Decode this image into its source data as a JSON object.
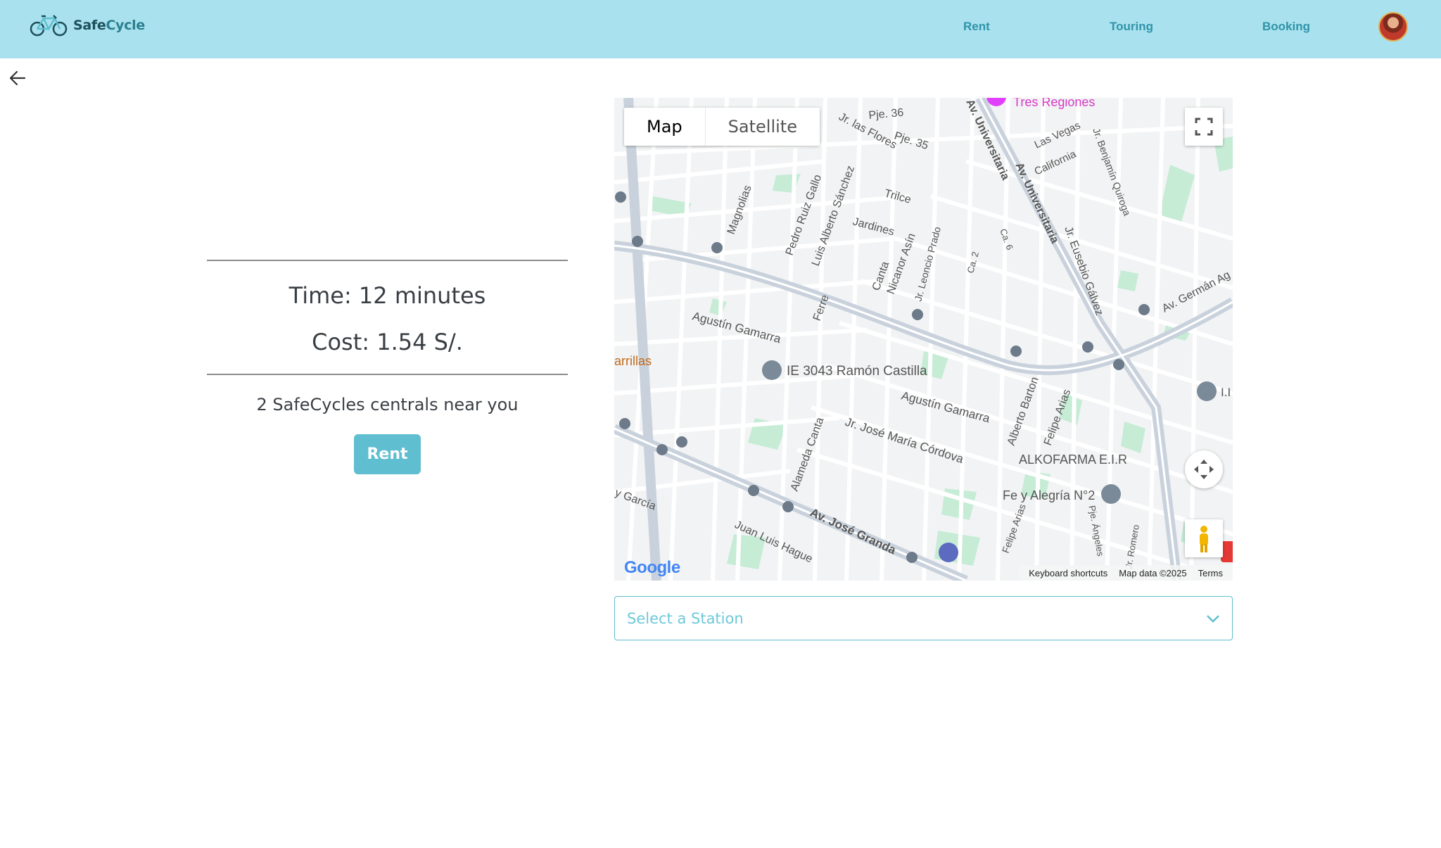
{
  "brand": {
    "name_part1": "Safe",
    "name_part2": "Cycle"
  },
  "nav": {
    "rent": "Rent",
    "touring": "Touring",
    "booking": "Booking"
  },
  "summary": {
    "time": "Time: 12 minutes",
    "cost": "Cost: 1.54 S/.",
    "centrals": "2 SafeCycles centrals near you",
    "rent_button": "Rent"
  },
  "map": {
    "type_map": "Map",
    "type_satellite": "Satellite",
    "google": "Google",
    "keyboard_shortcuts": "Keyboard shortcuts",
    "map_data": "Map data ©2025",
    "terms": "Terms",
    "labels": {
      "tres_regiones": "Tres Regiones",
      "pje36": "Pje. 36",
      "pje35": "Pje. 35",
      "las_flores": "Jr. las Flores",
      "las_vegas": "Las Vegas",
      "california": "California",
      "av_universitaria": "Av. Universitaria",
      "av_universitaria2": "Av. Universitaria",
      "benjamin": "Jr. Benjamín Quiroga",
      "magnolias": "Magnolias",
      "pedro": "Pedro Ruiz Gallo",
      "luis_alberto": "Luis Alberto Sánchez",
      "trilce": "Trilce",
      "jardines": "Jardines",
      "nicanor": "Nicanor Asín",
      "leoncio": "Jr. Leoncio Prado",
      "ca2": "Ca. 2",
      "ca6": "Ca. 6",
      "eusebio": "Jr. Eusebio Gálvez",
      "german": "Av. Germán Ag",
      "canta": "Canta",
      "ferre": "Ferre",
      "gamarra1": "Agustín Gamarra",
      "gamarra2": "Agustín Gamarra",
      "barrillas": "arrillas",
      "ie3043": "IE 3043 Ramón Castilla",
      "alberto_barton": "Alberto Barton",
      "felipe_arias": "Felipe Arias",
      "felipe_arias2": "Felipe Arias",
      "cordova": "Jr. José María Córdova",
      "alkofarma": "ALKOFARMA E.I.R",
      "fe_alegria": "Fe y Alegría N°2",
      "alameda": "Alameda Canta",
      "garcia": "y García",
      "av_jose_granda": "Av. José Granda",
      "juan_luis": "Juan Luis Hague",
      "romero": "Jr. Romero",
      "angeles": "Pje. Ángeles",
      "i_i": "I.I"
    }
  },
  "station_select": {
    "placeholder": "Select a Station"
  },
  "colors": {
    "navbar": "#a9e1ee",
    "accent": "#5fbecf",
    "nav_link": "#2f94a8"
  },
  "icons": {
    "logo": "bicycle-icon",
    "back": "arrow-left-icon",
    "fullscreen": "fullscreen-icon",
    "camera": "camera-control-icon",
    "pegman": "pegman-icon",
    "select": "chevron-down-icon"
  }
}
